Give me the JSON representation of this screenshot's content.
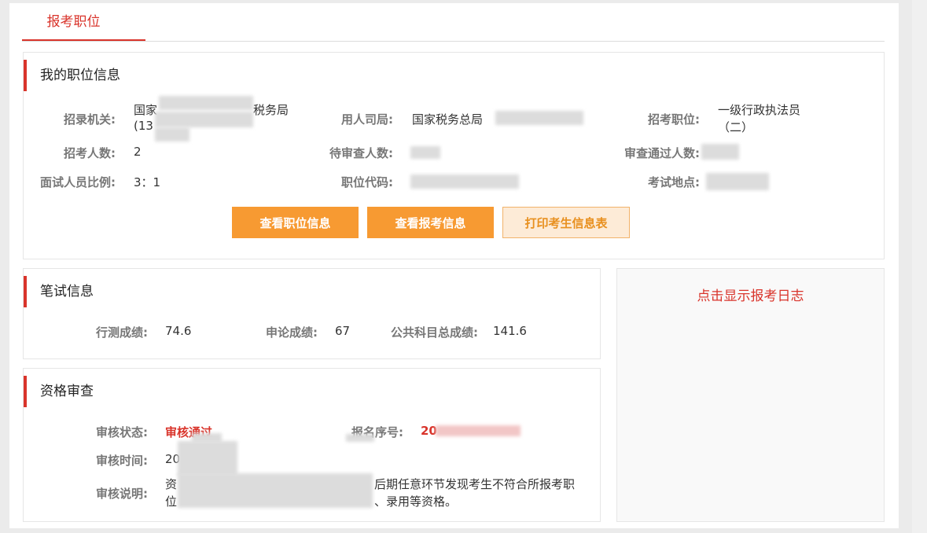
{
  "tabs": {
    "active_label": "报考职位"
  },
  "position_info": {
    "title": "我的职位信息",
    "recruit_org_label": "招录机关:",
    "recruit_org_value_line1": "国家",
    "recruit_org_value_suffix": "税务局",
    "recruit_org_value_line2": "(13",
    "employer_label": "用人司局:",
    "employer_value": "国家税务总局",
    "post_label": "招考职位:",
    "post_value_line1": "一级行政执法员",
    "post_value_line2": "（二）",
    "headcount_label": "招考人数:",
    "headcount_value": "2",
    "pending_label": "待审查人数:",
    "passed_label": "审查通过人数:",
    "interview_ratio_label": "面试人员比例:",
    "interview_ratio_value": "3：1",
    "post_code_label": "职位代码:",
    "exam_site_label": "考试地点:",
    "btn_view_post": "查看职位信息",
    "btn_view_application": "查看报考信息",
    "btn_print": "打印考生信息表"
  },
  "written_exam": {
    "title": "笔试信息",
    "xingce_label": "行测成绩:",
    "xingce_value": "74.6",
    "shenlun_label": "申论成绩:",
    "shenlun_value": "67",
    "total_label": "公共科目总成绩:",
    "total_value": "141.6"
  },
  "qualification": {
    "title": "资格审查",
    "status_label": "审核状态:",
    "status_value": "审核通过",
    "serial_label": "报名序号:",
    "serial_value": "20",
    "time_label": "审核时间:",
    "time_value": "20",
    "note_label": "审核说明:",
    "note_line1_start": "资",
    "note_line1_end": "后期任意环节发现考生不符合所报考职",
    "note_line2_start": "位",
    "note_line2_end": "、录用等资格。"
  },
  "log": {
    "link_label": "点击显示报考日志"
  },
  "colors": {
    "accent_red": "#d9342b",
    "button_orange": "#f79a32",
    "button_outline_bg": "#fdebd7"
  }
}
